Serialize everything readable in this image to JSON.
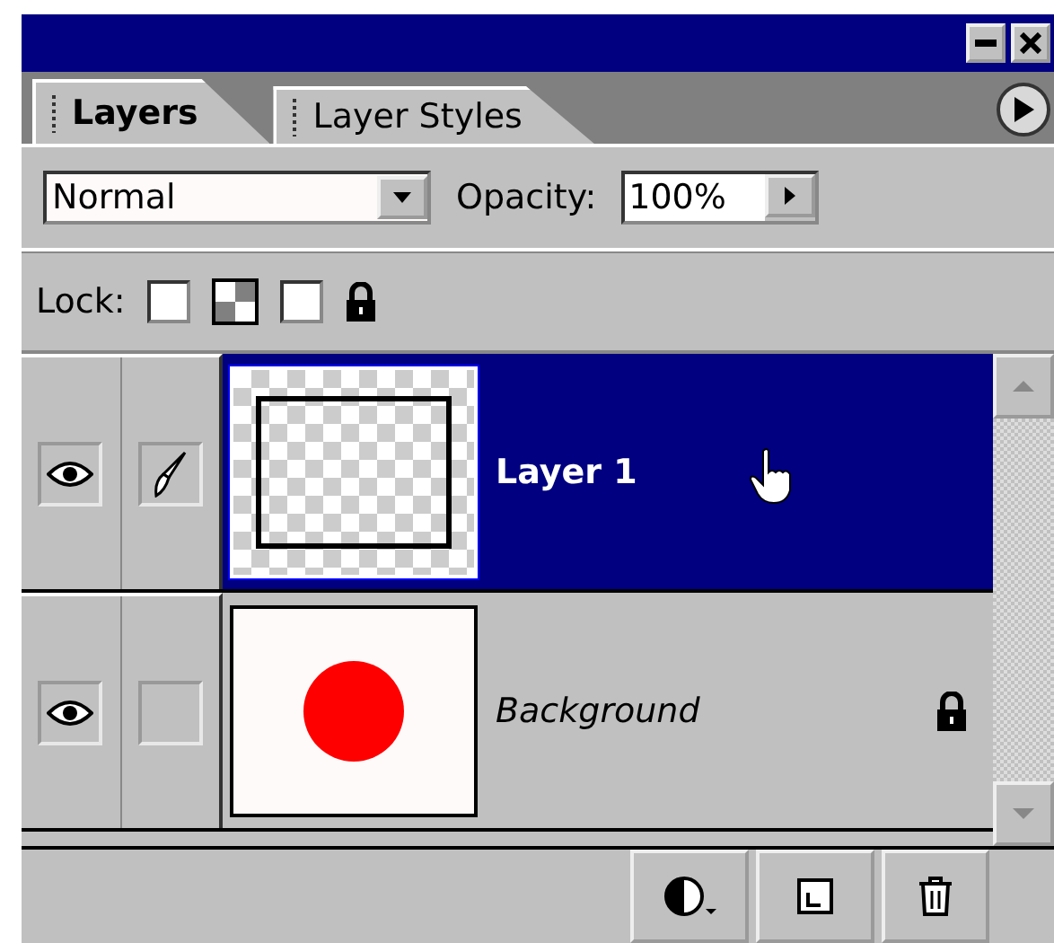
{
  "tabs": [
    {
      "label": "Layers",
      "selected": true
    },
    {
      "label": "Layer Styles",
      "selected": false
    }
  ],
  "blend_mode": {
    "value": "Normal"
  },
  "opacity": {
    "label": "Opacity:",
    "value": "100%"
  },
  "lock": {
    "label": "Lock:",
    "options": [
      {
        "kind": "transparency",
        "checked": false
      },
      {
        "kind": "position",
        "checked": false
      }
    ]
  },
  "layers": [
    {
      "name": "Layer 1",
      "kind": "layer",
      "selected": true,
      "visible": true,
      "brush": true,
      "locked": false
    },
    {
      "name": "Background",
      "kind": "background",
      "selected": false,
      "visible": true,
      "brush": false,
      "locked": true
    }
  ]
}
